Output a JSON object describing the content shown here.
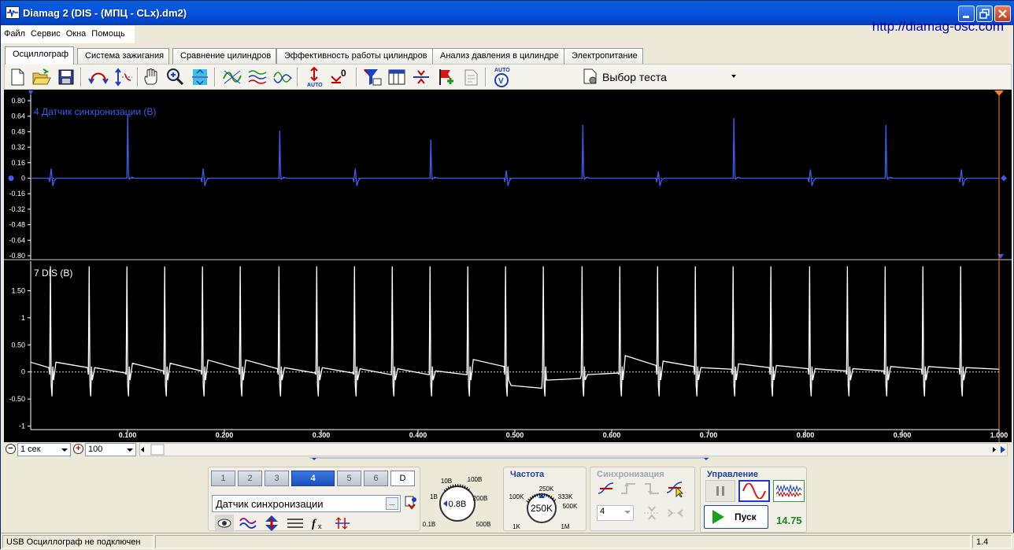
{
  "window": {
    "title": "Diamag 2 (DIS - (МПЦ - CLx).dm2)"
  },
  "menu": [
    "Файл",
    "Сервис",
    "Окна",
    "Помощь"
  ],
  "url": "http://diamag-osc.com",
  "tabs": [
    {
      "label": "Осциллограф",
      "active": true
    },
    {
      "label": "Система зажигания",
      "active": false
    },
    {
      "label": "Сравнение цилиндров",
      "active": false
    },
    {
      "label": "Эффективность работы цилиндров",
      "active": false
    },
    {
      "label": "Анализ давления в цилиндре",
      "active": false
    },
    {
      "label": "Электропитание",
      "active": false
    }
  ],
  "toolbar": {
    "icons": [
      "new-file-icon",
      "open-folder-icon",
      "save-icon",
      "horizontal-measure-icon",
      "vertical-measure-icon",
      "hand-pan-icon",
      "zoom-icon",
      "fit-icon",
      "cursor-wave-icon",
      "multi-wave-icon",
      "overlay-wave-icon",
      "auto-scale-icon",
      "zero-offset-icon",
      "filter-icon",
      "table-icon",
      "split-icon",
      "flag-add-icon",
      "notes-icon",
      "auto-voltage-icon"
    ],
    "test_select_label": "Выбор теста"
  },
  "scope": {
    "colors": {
      "ch1": "#3c5cf0",
      "ch2": "#ffffff",
      "axis": "#ffffff",
      "marker_left": "#3060ff",
      "marker_right": "#ff7a20"
    },
    "channel1": {
      "label": "4 Датчик синхронизации (В)",
      "y_ticks": [
        "0.80",
        "0.64",
        "0.48",
        "0.32",
        "0.16",
        "0",
        "-0.16",
        "-0.32",
        "-0.48",
        "-0.64",
        "-0.80"
      ],
      "ylim": [
        -0.8,
        0.8
      ]
    },
    "channel2": {
      "label": "7 DIS (В)",
      "y_ticks": [
        "1.50",
        "1",
        "0.50",
        "0",
        "-0.50",
        "-1"
      ],
      "ylim": [
        -1.05,
        2.0
      ]
    },
    "x_ticks": [
      "0.100",
      "0.200",
      "0.300",
      "0.400",
      "0.500",
      "0.600",
      "0.700",
      "0.800",
      "0.900",
      "1.000"
    ],
    "xlim": [
      0,
      1.0
    ]
  },
  "chart_data": [
    {
      "type": "line",
      "title": "4 Датчик синхронизации (В)",
      "xlim": [
        0,
        1.0
      ],
      "ylim": [
        -0.8,
        0.8
      ],
      "series": [
        {
          "name": "4 Датчик синхронизации (В)",
          "big_pulses": [
            [
              0.101,
              0.66
            ],
            [
              0.258,
              0.49
            ],
            [
              0.414,
              0.4
            ],
            [
              0.571,
              0.55
            ],
            [
              0.727,
              0.62
            ],
            [
              0.884,
              0.55
            ]
          ],
          "small_pulses": [
            [
              0.022,
              0.1
            ],
            [
              0.179,
              0.1
            ],
            [
              0.336,
              0.1
            ],
            [
              0.492,
              0.08
            ],
            [
              0.649,
              0.07
            ],
            [
              0.806,
              0.09
            ],
            [
              0.962,
              0.09
            ]
          ]
        }
      ]
    },
    {
      "type": "line",
      "title": "7 DIS (В)",
      "xlim": [
        0,
        1.0
      ],
      "ylim": [
        -1.0,
        2.0
      ],
      "series": [
        {
          "name": "7 DIS (В)",
          "spikes_x": [
            0.022,
            0.062,
            0.101,
            0.14,
            0.179,
            0.218,
            0.258,
            0.297,
            0.336,
            0.375,
            0.414,
            0.453,
            0.492,
            0.531,
            0.571,
            0.61,
            0.649,
            0.688,
            0.727,
            0.766,
            0.806,
            0.845,
            0.884,
            0.923,
            0.962
          ],
          "baseline_segments": [
            [
              0.0,
              0.18,
              0.08
            ],
            [
              0.062,
              0.08,
              -0.02
            ],
            [
              0.101,
              0.16,
              0.02
            ],
            [
              0.179,
              0.22,
              0.06
            ],
            [
              0.258,
              0.08,
              -0.02
            ],
            [
              0.336,
              0.06,
              -0.05
            ],
            [
              0.414,
              0.02,
              -0.05
            ],
            [
              0.453,
              0.23,
              0.1
            ],
            [
              0.492,
              -0.25,
              -0.3
            ],
            [
              0.531,
              -0.15,
              -0.12
            ],
            [
              0.571,
              -0.05,
              -0.02
            ],
            [
              0.61,
              0.3,
              0.12
            ],
            [
              0.649,
              0.2,
              0.1
            ],
            [
              0.688,
              0.08,
              0.05
            ],
            [
              0.727,
              0.15,
              0.08
            ],
            [
              0.766,
              0.12,
              0.06
            ],
            [
              0.806,
              0.06,
              0.02
            ],
            [
              0.845,
              0.06,
              0.02
            ],
            [
              0.884,
              0.1,
              0.05
            ],
            [
              0.923,
              0.1,
              0.06
            ],
            [
              0.962,
              0.08,
              0.05
            ]
          ]
        }
      ]
    }
  ],
  "timebase": {
    "value": "1 сек",
    "zoom": "100"
  },
  "channels": {
    "buttons": [
      "1",
      "2",
      "3",
      "4",
      "5",
      "6",
      "D"
    ],
    "active": "4",
    "sensor": "Датчик синхронизации"
  },
  "voltage_dial": {
    "labels": [
      "10В",
      "100В",
      "1В",
      "200В",
      "0.1В",
      "500В"
    ],
    "value": "0.8В"
  },
  "frequency": {
    "title": "Частота",
    "labels": [
      "250K",
      "100K",
      "333K",
      "500K",
      "1K",
      "1M"
    ],
    "value": "250K"
  },
  "sync": {
    "title": "Синхронизация",
    "channel": "4"
  },
  "control": {
    "title": "Управление",
    "start_label": "Пуск",
    "value": "14.75"
  },
  "status": {
    "left": "USB Осциллограф не подключен",
    "right": "1.4"
  }
}
